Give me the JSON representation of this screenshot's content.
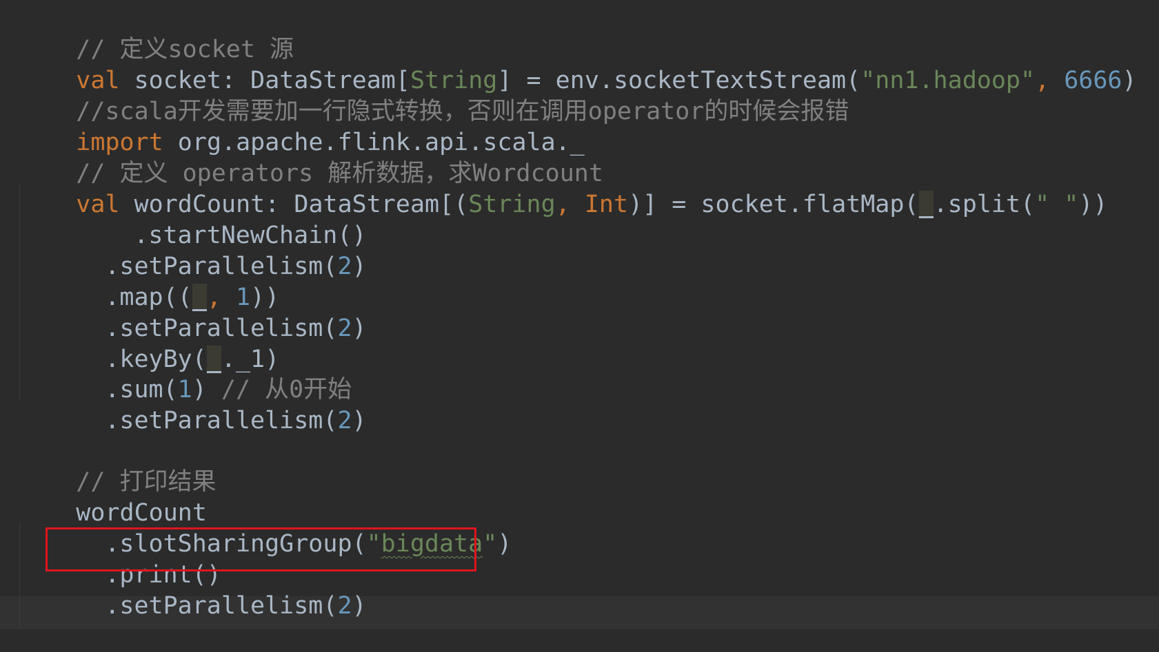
{
  "code": {
    "l1": {
      "comment": "// 定义socket 源"
    },
    "l2": {
      "kw": "val",
      "name": " socket: DataStream[",
      "type": "String",
      "mid": "] = env.socketTextStream(",
      "host": "\"nn1.hadoop\"",
      "comma": ", ",
      "port": "6666",
      "end": ")"
    },
    "l3": {
      "comment": "//scala开发需要加一行隐式转换，否则在调用operator的时候会报错"
    },
    "l4": {
      "kw": "import",
      "rest": " org.apache.flink.api.scala._"
    },
    "l5": {
      "comment": "// 定义 operators 解析数据，求Wordcount"
    },
    "l6": {
      "kw": "val",
      "name": " wordCount: DataStream[(",
      "type1": "String",
      "comma": ", ",
      "type2": "Int",
      "mid": ")] = socket.flatMap(",
      "ph": "_",
      "rest": ".split(",
      "str": "\" \"",
      "end": "))"
    },
    "l7": {
      "text": ".startNewChain()"
    },
    "l8": {
      "pre": ".setParallelism(",
      "num": "2",
      "end": ")"
    },
    "l9": {
      "pre": ".map((",
      "ph": "_",
      "comma": ", ",
      "num": "1",
      "end": "))"
    },
    "l10": {
      "pre": ".setParallelism(",
      "num": "2",
      "end": ")"
    },
    "l11": {
      "pre": ".keyBy(",
      "ph": "_",
      "end": "._1)"
    },
    "l12": {
      "pre": ".sum(",
      "num": "1",
      "end": ") ",
      "comment": "// 从0开始"
    },
    "l13": {
      "pre": ".setParallelism(",
      "num": "2",
      "end": ")"
    },
    "l15": {
      "comment": "// 打印结果"
    },
    "l16": {
      "text": "wordCount"
    },
    "l17": {
      "pre": ".slotSharingGroup(",
      "q1": "\"",
      "str": "bigdata",
      "q2": "\"",
      "end": ")"
    },
    "l18": {
      "text": ".print()"
    },
    "l19": {
      "pre": ".setParallelism(",
      "num": "2",
      "end": ")"
    }
  }
}
